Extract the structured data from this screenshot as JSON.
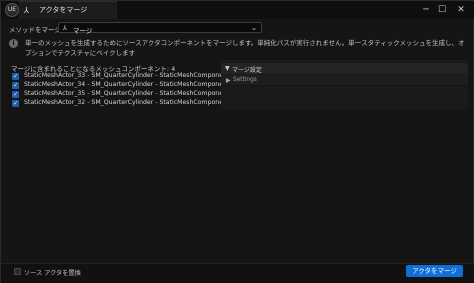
{
  "window": {
    "app_logo": "UE",
    "tab_label": "アクタをマージ",
    "tab_icon": "merge-actors-icon",
    "controls": {
      "minimize": "─",
      "maximize": "☐",
      "close": "✕"
    }
  },
  "method": {
    "label": "メソッドをマージ",
    "selected": "マージ",
    "icon": "merge-icon"
  },
  "info": {
    "text": "単一のメッシュを生成するためにソースアクタコンポーネントをマージします。単純化パスが実行されません。単一スタティックメッシュを生成し、オプションでテクスチャにベイクします"
  },
  "components": {
    "header": "マージに含まれることになるメッシュコンポーネント: 4",
    "items": [
      {
        "label": "StaticMeshActor_33 - SM_QuarterCylinder - StaticMeshComponent0",
        "checked": true
      },
      {
        "label": "StaticMeshActor_34 - SM_QuarterCylinder - StaticMeshComponent0",
        "checked": true
      },
      {
        "label": "StaticMeshActor_35 - SM_QuarterCylinder - StaticMeshComponent0",
        "checked": true
      },
      {
        "label": "StaticMeshActor_32 - SM_QuarterCylinder - StaticMeshComponent0",
        "checked": true
      }
    ]
  },
  "settings_panel": {
    "section_title": "マージ設定",
    "row_label": "Settings"
  },
  "footer": {
    "replace_label": "ソース アクタを置換",
    "replace_checked": false,
    "merge_button": "アクタをマージ"
  },
  "colors": {
    "accent": "#0f6fd8",
    "checkbox": "#1d5fae",
    "background": "#151515"
  }
}
